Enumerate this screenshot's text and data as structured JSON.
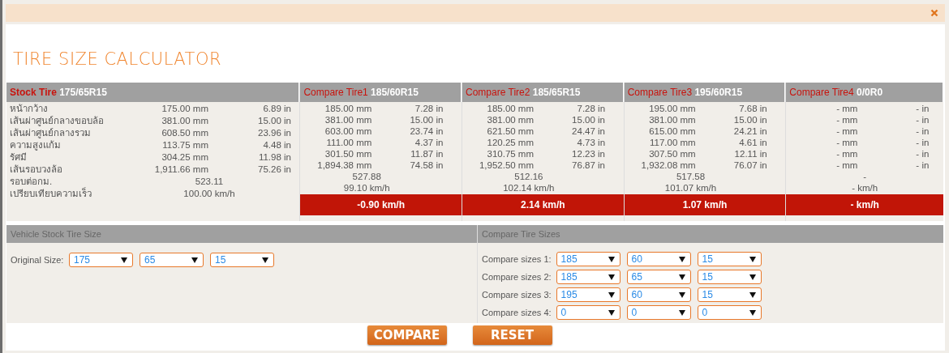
{
  "title": "TIRE SIZE CALCULATOR",
  "stock": {
    "label": "Stock Tire",
    "size": "175/65R15",
    "rows": [
      {
        "label": "หน้ากว้าง",
        "mm": "175.00 mm",
        "in": "6.89 in"
      },
      {
        "label": "เส้นผ่าศูนย์กลางขอบล้อ",
        "mm": "381.00 mm",
        "in": "15.00 in"
      },
      {
        "label": "เส้นผ่าศูนย์กลางรวม",
        "mm": "608.50 mm",
        "in": "23.96 in"
      },
      {
        "label": "ความสูงแก้ม",
        "mm": "113.75 mm",
        "in": "4.48 in"
      },
      {
        "label": "รัศมี",
        "mm": "304.25 mm",
        "in": "11.98 in"
      },
      {
        "label": "เส้นรอบวงล้อ",
        "mm": "1,911.66 mm",
        "in": "75.26 in"
      }
    ],
    "revs_label": "รอบต่อกม.",
    "revs": "523.11",
    "speed_label": "เปรียบเทียบความเร็ว",
    "speed": "100.00 km/h"
  },
  "compares": [
    {
      "label": "Compare Tire1",
      "size": "185/60R15",
      "rows": [
        {
          "mm": "185.00 mm",
          "in": "7.28 in"
        },
        {
          "mm": "381.00 mm",
          "in": "15.00 in"
        },
        {
          "mm": "603.00 mm",
          "in": "23.74 in"
        },
        {
          "mm": "111.00 mm",
          "in": "4.37 in"
        },
        {
          "mm": "301.50 mm",
          "in": "11.87 in"
        },
        {
          "mm": "1,894.38 mm",
          "in": "74.58 in"
        }
      ],
      "revs": "527.88",
      "speed": "99.10 km/h",
      "diff": "-0.90 km/h"
    },
    {
      "label": "Compare Tire2",
      "size": "185/65R15",
      "rows": [
        {
          "mm": "185.00 mm",
          "in": "7.28 in"
        },
        {
          "mm": "381.00 mm",
          "in": "15.00 in"
        },
        {
          "mm": "621.50 mm",
          "in": "24.47 in"
        },
        {
          "mm": "120.25 mm",
          "in": "4.73 in"
        },
        {
          "mm": "310.75 mm",
          "in": "12.23 in"
        },
        {
          "mm": "1,952.50 mm",
          "in": "76.87 in"
        }
      ],
      "revs": "512.16",
      "speed": "102.14 km/h",
      "diff": "2.14 km/h"
    },
    {
      "label": "Compare Tire3",
      "size": "195/60R15",
      "rows": [
        {
          "mm": "195.00 mm",
          "in": "7.68 in"
        },
        {
          "mm": "381.00 mm",
          "in": "15.00 in"
        },
        {
          "mm": "615.00 mm",
          "in": "24.21 in"
        },
        {
          "mm": "117.00 mm",
          "in": "4.61 in"
        },
        {
          "mm": "307.50 mm",
          "in": "12.11 in"
        },
        {
          "mm": "1,932.08 mm",
          "in": "76.07 in"
        }
      ],
      "revs": "517.58",
      "speed": "101.07 km/h",
      "diff": "1.07 km/h"
    },
    {
      "label": "Compare Tire4",
      "size": "0/0R0",
      "rows": [
        {
          "mm": "- mm",
          "in": "- in"
        },
        {
          "mm": "- mm",
          "in": "- in"
        },
        {
          "mm": "- mm",
          "in": "- in"
        },
        {
          "mm": "- mm",
          "in": "- in"
        },
        {
          "mm": "- mm",
          "in": "- in"
        },
        {
          "mm": "- mm",
          "in": "- in"
        }
      ],
      "revs": "-",
      "speed": "- km/h",
      "diff": "- km/h"
    }
  ],
  "stock_panel": {
    "title": "Vehicle Stock Tire Size",
    "rows": [
      {
        "label": "Original Size:",
        "values": [
          "175",
          "65",
          "15"
        ]
      }
    ]
  },
  "compare_panel": {
    "title": "Compare Tire Sizes",
    "rows": [
      {
        "label": "Compare sizes 1:",
        "values": [
          "185",
          "60",
          "15"
        ]
      },
      {
        "label": "Compare sizes 2:",
        "values": [
          "185",
          "65",
          "15"
        ]
      },
      {
        "label": "Compare sizes 3:",
        "values": [
          "195",
          "60",
          "15"
        ]
      },
      {
        "label": "Compare sizes 4:",
        "values": [
          "0",
          "0",
          "0"
        ]
      }
    ]
  },
  "buttons": [
    "COMPARE",
    "RESET"
  ]
}
